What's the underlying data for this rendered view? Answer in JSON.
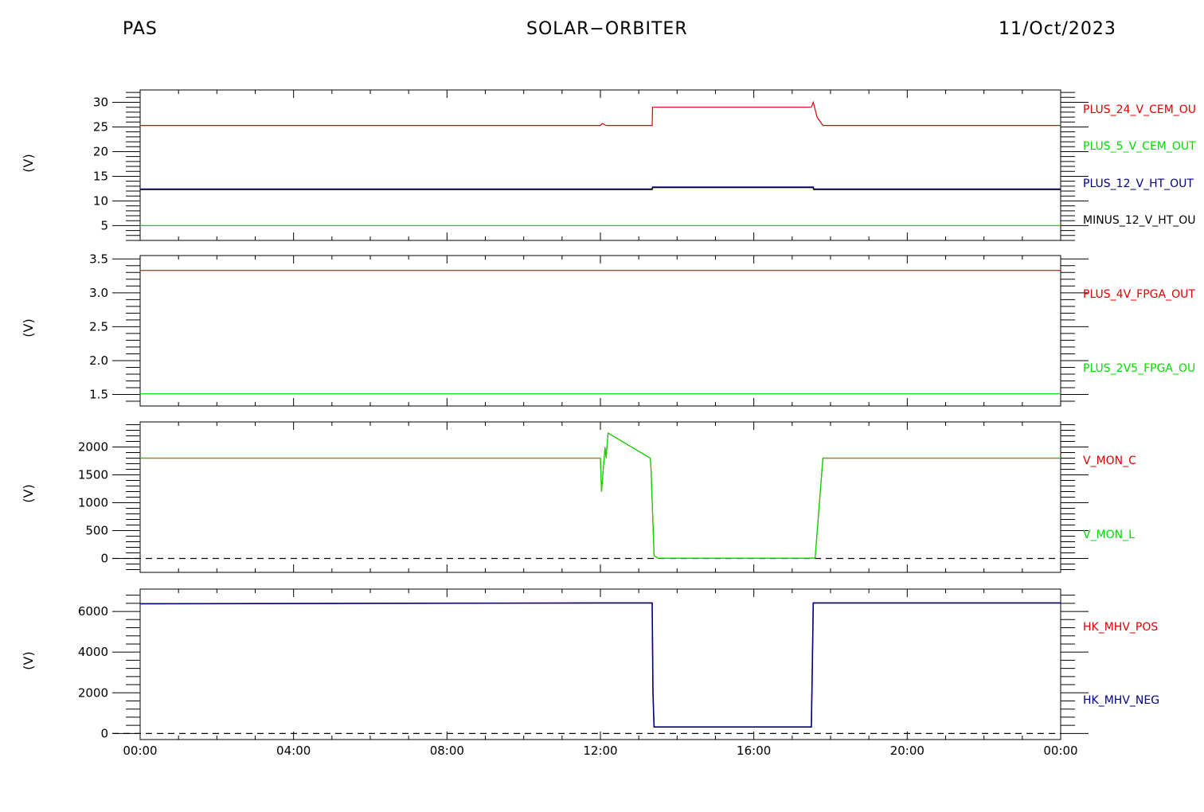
{
  "header": {
    "left": "PAS",
    "center": "SOLAR−ORBITER",
    "right": "11/Oct/2023"
  },
  "colors": {
    "red": "#dd0000",
    "green": "#00dd00",
    "navy": "#000080",
    "black": "#000000"
  },
  "chart_data": [
    {
      "type": "line",
      "ylabel": "(V)",
      "ylim": [
        2.0,
        32.5
      ],
      "yticks": [
        5,
        10,
        15,
        20,
        25,
        30
      ],
      "ytick_labels": [
        "5",
        "10",
        "15",
        "20",
        "25",
        "30"
      ],
      "xlim": [
        0,
        24
      ],
      "legend": [
        "PLUS_24_V_CEM_OU",
        "PLUS_5_V_CEM_OUT",
        "PLUS_12_V_HT_OUT",
        "MINUS_12_V_HT_OU"
      ],
      "series": [
        {
          "name": "PLUS_24_V_CEM_OU",
          "color": "red",
          "x": [
            0,
            12.0,
            12.05,
            12.15,
            12.3,
            13.35,
            13.36,
            17.5,
            17.55,
            17.65,
            17.8,
            24
          ],
          "y": [
            25.3,
            25.3,
            25.7,
            25.3,
            25.3,
            25.3,
            29.0,
            29.0,
            30.0,
            27.0,
            25.3,
            25.3
          ]
        },
        {
          "name": "PLUS_5_V_CEM_OUT",
          "color": "green",
          "x": [
            0,
            24
          ],
          "y": [
            5.0,
            5.0
          ]
        },
        {
          "name": "PLUS_12_V_HT_OUT",
          "color": "navy",
          "x": [
            0,
            13.35,
            13.36,
            17.55,
            17.56,
            24
          ],
          "y": [
            12.4,
            12.4,
            12.8,
            12.8,
            12.4,
            12.4
          ]
        },
        {
          "name": "MINUS_12_V_HT_OU",
          "color": "black",
          "x": [
            0,
            13.35,
            13.36,
            17.55,
            17.56,
            24
          ],
          "y": [
            12.3,
            12.3,
            12.7,
            12.7,
            12.3,
            12.3
          ]
        }
      ]
    },
    {
      "type": "line",
      "ylabel": "(V)",
      "ylim": [
        1.33,
        3.55
      ],
      "yticks": [
        1.5,
        2.0,
        2.5,
        3.0,
        3.5
      ],
      "ytick_labels": [
        "1.5",
        "2.0",
        "2.5",
        "3.0",
        "3.5"
      ],
      "xlim": [
        0,
        24
      ],
      "legend": [
        "PLUS_4V_FPGA_OUT",
        "PLUS_2V5_FPGA_OU"
      ],
      "series": [
        {
          "name": "PLUS_4V_FPGA_OUT",
          "color": "red",
          "x": [
            0,
            24
          ],
          "y": [
            3.33,
            3.33
          ]
        },
        {
          "name": "PLUS_2V5_FPGA_OU",
          "color": "green",
          "x": [
            0,
            24
          ],
          "y": [
            1.51,
            1.51
          ]
        }
      ]
    },
    {
      "type": "line",
      "ylabel": "(V)",
      "ylim": [
        -250,
        2450
      ],
      "yticks": [
        0,
        500,
        1000,
        1500,
        2000
      ],
      "ytick_labels": [
        "0",
        "500",
        "1000",
        "1500",
        "2000"
      ],
      "xlim": [
        0,
        24
      ],
      "zero_line": true,
      "legend": [
        "V_MON_C",
        "V_MON_L"
      ],
      "series": [
        {
          "name": "V_MON_C",
          "color": "red",
          "x": [
            0,
            12.0,
            12.03,
            12.12,
            12.15,
            12.2,
            13.3,
            13.32,
            13.4,
            13.5,
            17.5,
            17.6,
            17.8,
            24
          ],
          "y": [
            1800,
            1800,
            1200,
            2000,
            1800,
            2250,
            1800,
            1600,
            50,
            5,
            5,
            10,
            1800,
            1800
          ]
        },
        {
          "name": "V_MON_L",
          "color": "green",
          "x": [
            0,
            12.0,
            12.03,
            12.12,
            12.15,
            12.2,
            13.3,
            13.32,
            13.4,
            13.5,
            17.5,
            17.6,
            17.8,
            24
          ],
          "y": [
            1800,
            1800,
            1200,
            2000,
            1800,
            2250,
            1800,
            1600,
            50,
            5,
            5,
            10,
            1800,
            1800
          ]
        }
      ]
    },
    {
      "type": "line",
      "ylabel": "(V)",
      "ylim": [
        -300,
        7100
      ],
      "yticks": [
        0,
        2000,
        4000,
        6000
      ],
      "ytick_labels": [
        "0",
        "2000",
        "4000",
        "6000"
      ],
      "xlim": [
        0,
        24
      ],
      "zero_line": true,
      "xticks": [
        0,
        4,
        8,
        12,
        16,
        20,
        24
      ],
      "xtick_labels": [
        "00:00",
        "04:00",
        "08:00",
        "12:00",
        "16:00",
        "20:00",
        "00:00"
      ],
      "legend": [
        "HK_MHV_POS",
        "HK_MHV_NEG"
      ],
      "series": [
        {
          "name": "HK_MHV_POS",
          "color": "red",
          "x": [
            0,
            12.2,
            13.35,
            13.37,
            13.4,
            17.5,
            17.52,
            17.55,
            24
          ],
          "y": [
            6380,
            6420,
            6420,
            2000,
            320,
            320,
            2700,
            6420,
            6420
          ]
        },
        {
          "name": "HK_MHV_NEG",
          "color": "navy",
          "x": [
            0,
            12.2,
            13.35,
            13.37,
            13.4,
            17.5,
            17.52,
            17.55,
            24
          ],
          "y": [
            6380,
            6420,
            6420,
            2000,
            320,
            320,
            2700,
            6420,
            6420
          ]
        }
      ]
    }
  ]
}
